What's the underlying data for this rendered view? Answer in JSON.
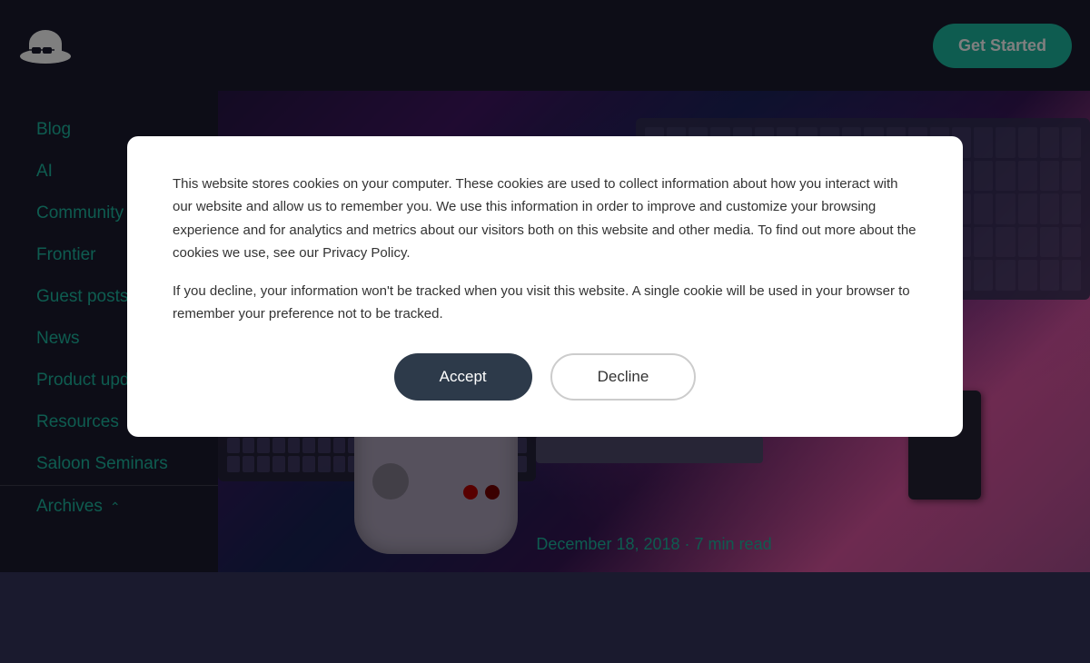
{
  "header": {
    "get_started_label": "Get Started"
  },
  "sidebar": {
    "items": [
      {
        "label": "Blog",
        "id": "blog"
      },
      {
        "label": "AI",
        "id": "ai"
      },
      {
        "label": "Community",
        "id": "community"
      },
      {
        "label": "Frontier",
        "id": "frontier"
      },
      {
        "label": "Guest posts",
        "id": "guest-posts"
      },
      {
        "label": "News",
        "id": "news"
      },
      {
        "label": "Product updates",
        "id": "product-updates"
      },
      {
        "label": "Resources",
        "id": "resources"
      },
      {
        "label": "Saloon Seminars",
        "id": "saloon-seminars"
      }
    ],
    "archives_label": "Archives",
    "archives_chevron": "^"
  },
  "article": {
    "date": "December 18, 2018",
    "read_time": "7 min read",
    "separator": "·"
  },
  "cookie_modal": {
    "text1": "This website stores cookies on your computer. These cookies are used to collect information about how you interact with our website and allow us to remember you. We use this information in order to improve and customize your browsing experience and for analytics and metrics about our visitors both on this website and other media. To find out more about the cookies we use, see our Privacy Policy.",
    "text2": "If you decline, your information won't be tracked when you visit this website. A single cookie will be used in your browser to remember your preference not to be tracked.",
    "accept_label": "Accept",
    "decline_label": "Decline"
  },
  "colors": {
    "accent": "#1db8a0",
    "dark_bg": "#1a1a2e",
    "modal_bg": "#ffffff"
  }
}
